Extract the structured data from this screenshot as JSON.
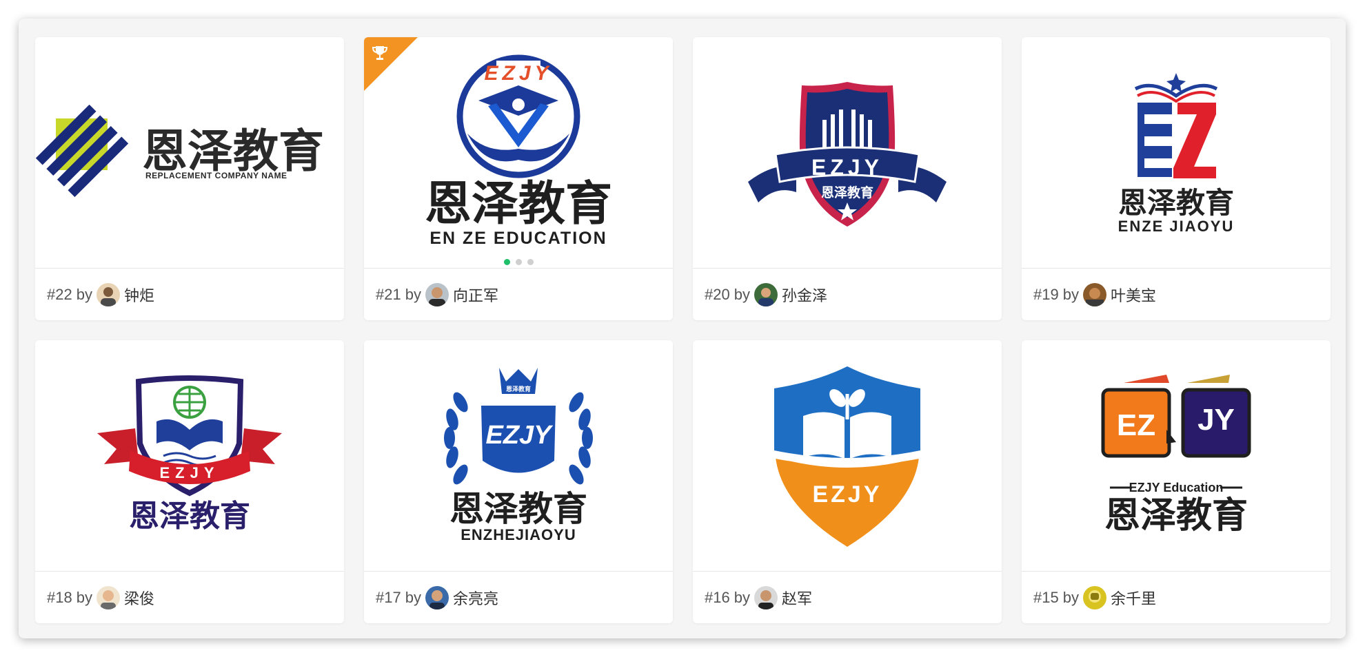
{
  "gallery": {
    "items": [
      {
        "rank": "#22",
        "by": "by",
        "author": "钟炬",
        "logo_title": "恩泽教育",
        "logo_subtitle": "REPLACEMENT COMPANY NAME"
      },
      {
        "rank": "#21",
        "by": "by",
        "author": "向正军",
        "logo_title": "恩泽教育",
        "logo_subtitle": "EN ZE EDUCATION",
        "logo_arc": "EZJY",
        "winner": true
      },
      {
        "rank": "#20",
        "by": "by",
        "author": "孙金泽",
        "logo_title": "恩泽教育",
        "logo_badge": "EZJY"
      },
      {
        "rank": "#19",
        "by": "by",
        "author": "叶美宝",
        "logo_title": "恩泽教育",
        "logo_subtitle": "ENZE JIAOYU"
      },
      {
        "rank": "#18",
        "by": "by",
        "author": "梁俊",
        "logo_title": "恩泽教育",
        "logo_badge": "EZJY"
      },
      {
        "rank": "#17",
        "by": "by",
        "author": "余亮亮",
        "logo_title": "恩泽教育",
        "logo_subtitle": "ENZHEJIAOYU",
        "logo_badge": "EZJY",
        "logo_crown": "恩泽教育"
      },
      {
        "rank": "#16",
        "by": "by",
        "author": "赵军",
        "logo_badge": "EZJY"
      },
      {
        "rank": "#15",
        "by": "by",
        "author": "余千里",
        "logo_title": "恩泽教育",
        "logo_subtitle": "EZJY Education",
        "logo_left": "EZ",
        "logo_right": "JY"
      }
    ],
    "carousel": {
      "slides": 3,
      "active": 1
    }
  },
  "colors": {
    "ribbon": "#f39322",
    "dot_active": "#1fbf6a",
    "dot_inactive": "#cfcfcf",
    "meta_text": "#555555"
  },
  "icons": {
    "winner": "trophy-icon"
  }
}
